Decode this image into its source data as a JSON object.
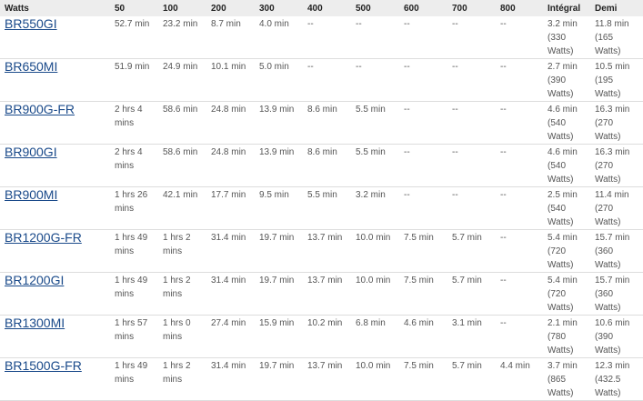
{
  "table": {
    "headers": [
      "Watts",
      "50",
      "100",
      "200",
      "300",
      "400",
      "500",
      "600",
      "700",
      "800",
      "Intégral",
      "Demi"
    ],
    "rows": [
      [
        "BR550GI",
        "52.7 min",
        "23.2 min",
        "8.7 min",
        "4.0 min",
        "--",
        "--",
        "--",
        "--",
        "--",
        "3.2 min (330 Watts)",
        "11.8 min (165 Watts)"
      ],
      [
        "BR650MI",
        "51.9 min",
        "24.9 min",
        "10.1 min",
        "5.0 min",
        "--",
        "--",
        "--",
        "--",
        "--",
        "2.7 min (390 Watts)",
        "10.5 min (195 Watts)"
      ],
      [
        "BR900G-FR",
        "2 hrs 4 mins",
        "58.6 min",
        "24.8 min",
        "13.9 min",
        "8.6 min",
        "5.5 min",
        "--",
        "--",
        "--",
        "4.6 min (540 Watts)",
        "16.3 min (270 Watts)"
      ],
      [
        "BR900GI",
        "2 hrs 4 mins",
        "58.6 min",
        "24.8 min",
        "13.9 min",
        "8.6 min",
        "5.5 min",
        "--",
        "--",
        "--",
        "4.6 min (540 Watts)",
        "16.3 min (270 Watts)"
      ],
      [
        "BR900MI",
        "1 hrs 26 mins",
        "42.1 min",
        "17.7 min",
        "9.5 min",
        "5.5 min",
        "3.2 min",
        "--",
        "--",
        "--",
        "2.5 min (540 Watts)",
        "11.4 min (270 Watts)"
      ],
      [
        "BR1200G-FR",
        "1 hrs 49 mins",
        "1 hrs 2 mins",
        "31.4 min",
        "19.7 min",
        "13.7 min",
        "10.0 min",
        "7.5 min",
        "5.7 min",
        "--",
        "5.4 min (720 Watts)",
        "15.7 min (360 Watts)"
      ],
      [
        "BR1200GI",
        "1 hrs 49 mins",
        "1 hrs 2 mins",
        "31.4 min",
        "19.7 min",
        "13.7 min",
        "10.0 min",
        "7.5 min",
        "5.7 min",
        "--",
        "5.4 min (720 Watts)",
        "15.7 min (360 Watts)"
      ],
      [
        "BR1300MI",
        "1 hrs 57 mins",
        "1 hrs 0 mins",
        "27.4 min",
        "15.9 min",
        "10.2 min",
        "6.8 min",
        "4.6 min",
        "3.1 min",
        "--",
        "2.1 min (780 Watts)",
        "10.6 min (390 Watts)"
      ],
      [
        "BR1500G-FR",
        "1 hrs 49 mins",
        "1 hrs 2 mins",
        "31.4 min",
        "19.7 min",
        "13.7 min",
        "10.0 min",
        "7.5 min",
        "5.7 min",
        "4.4 min",
        "3.7 min (865 Watts)",
        "12.3 min (432.5 Watts)"
      ]
    ]
  },
  "colors": {
    "header_bg": "#ededed",
    "link": "#1a4a8a",
    "text": "#555555",
    "row_border": "#dddddd"
  }
}
